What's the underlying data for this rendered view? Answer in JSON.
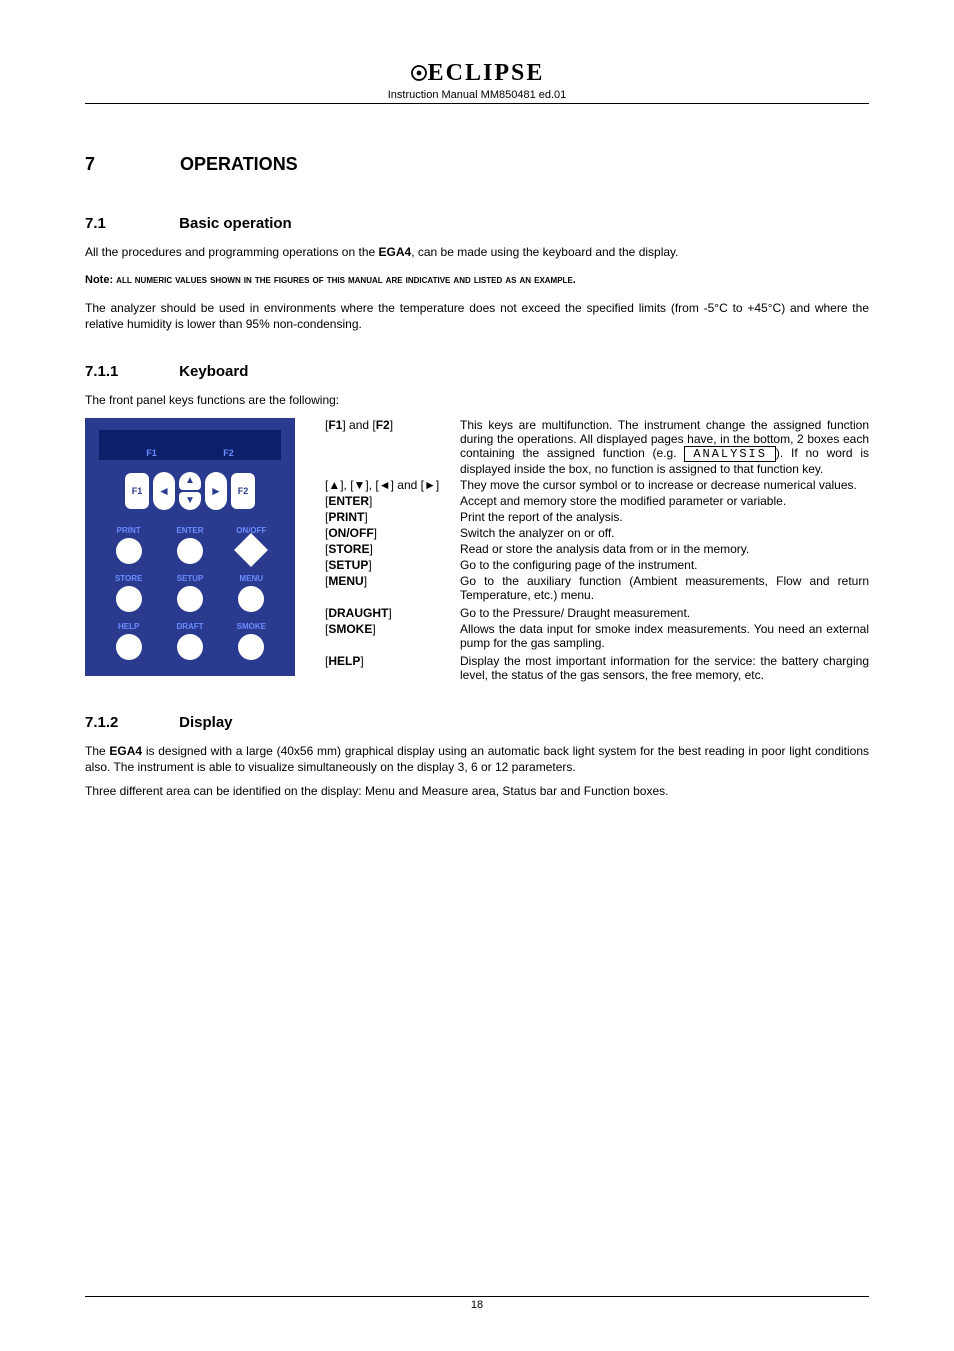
{
  "header": {
    "logo_text": "ECLIPSE",
    "subtitle": "Instruction Manual MM850481 ed.01"
  },
  "section": {
    "num": "7",
    "title": "OPERATIONS"
  },
  "sub1": {
    "num": "7.1",
    "title": "Basic operation",
    "p1_a": "All the procedures and programming operations on the ",
    "p1_b": "EGA4",
    "p1_c": ", can be made using the keyboard and the display.",
    "note_a": "Note: ",
    "note_b": "all numeric values shown in the figures of this manual are indicative and listed as an example.",
    "p2": "The analyzer should be used in environments where the temperature does not exceed the specified limits (from -5°C to +45°C) and where the relative humidity is lower than 95% non-condensing."
  },
  "sub2": {
    "num": "7.1.1",
    "title": "Keyboard",
    "intro": "The front panel keys functions are the following:"
  },
  "panel": {
    "lcd_f1": "F1",
    "lcd_f2": "F2",
    "soft_f1": "F1",
    "soft_f2": "F2",
    "buttons": [
      {
        "label": "PRINT",
        "shape": "round"
      },
      {
        "label": "ENTER",
        "shape": "round"
      },
      {
        "label": "ON/OFF",
        "shape": "diamond"
      },
      {
        "label": "STORE",
        "shape": "round"
      },
      {
        "label": "SETUP",
        "shape": "round"
      },
      {
        "label": "MENU",
        "shape": "round"
      },
      {
        "label": "HELP",
        "shape": "round"
      },
      {
        "label": "DRAFT",
        "shape": "round"
      },
      {
        "label": "SMOKE",
        "shape": "round"
      }
    ]
  },
  "keydesc": {
    "fn_box": "ANALYSIS",
    "rows": [
      {
        "key_html": "[<b>F1</b>] and [<b>F2</b>]",
        "desc_pre": "This keys are multifunction. The instrument change the assigned function during the operations. All displayed pages have, in the bottom, 2 boxes each containing the assigned function (e.g. ",
        "desc_post": "). If no word is displayed inside the box, no function is assigned to that function key.",
        "has_box": true
      },
      {
        "key_html": "[▲], [▼], [◄] and [►]",
        "desc": "They move the cursor symbol or to increase or decrease numerical values."
      },
      {
        "key_html": "[<b>ENTER</b>]",
        "desc": "Accept and memory store the modified parameter or variable."
      },
      {
        "key_html": "[<b>PRINT</b>]",
        "desc": "Print the report of the analysis."
      },
      {
        "key_html": "[<b>ON/OFF</b>]",
        "desc": "Switch the analyzer on or off."
      },
      {
        "key_html": "[<b>STORE</b>]",
        "desc": "Read or store the analysis data from or in the memory."
      },
      {
        "key_html": "[<b>SETUP</b>]",
        "desc": "Go to the configuring page of the instrument."
      },
      {
        "key_html": "[<b>MENU</b>]",
        "desc": "Go to the auxiliary function (Ambient measurements, Flow and return Temperature, etc.) menu."
      },
      {
        "key_html": "[<b>DRAUGHT</b>]",
        "desc": "Go to the Pressure/ Draught measurement."
      },
      {
        "key_html": "[<b>SMOKE</b>]",
        "desc": "Allows the data input for smoke index measurements. You need an external pump for the gas sampling."
      },
      {
        "key_html": "[<b>HELP</b>]",
        "desc": "Display the most important information for the service: the battery charging level, the status of the gas sensors, the free memory, etc."
      }
    ]
  },
  "sub3": {
    "num": "7.1.2",
    "title": "Display",
    "p1_a": "The ",
    "p1_b": "EGA4",
    "p1_c": " is designed with a large (40x56 mm) graphical display using an automatic back light system for the best reading in poor light conditions also. The instrument is able to visualize simultaneously on the display 3, 6 or 12 parameters.",
    "p2": "Three different area can be identified on the display: Menu and Measure area, Status bar and Function boxes."
  },
  "footer": {
    "page": "18"
  }
}
